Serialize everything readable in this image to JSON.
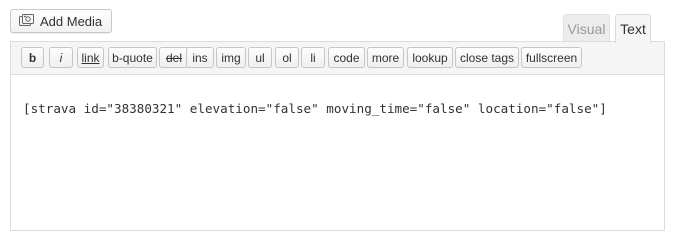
{
  "media": {
    "add_media_label": "Add Media",
    "icon": "media-camera-icon"
  },
  "tabs": [
    {
      "label": "Visual",
      "active": false
    },
    {
      "label": "Text",
      "active": true
    }
  ],
  "toolbar": {
    "buttons": [
      "b",
      "i",
      "link",
      "b-quote",
      "del",
      "ins",
      "img",
      "ul",
      "ol",
      "li",
      "code",
      "more",
      "lookup",
      "close tags",
      "fullscreen"
    ]
  },
  "editor": {
    "content": "[strava id=\"38380321\" elevation=\"false\" moving_time=\"false\" location=\"false\"]"
  }
}
